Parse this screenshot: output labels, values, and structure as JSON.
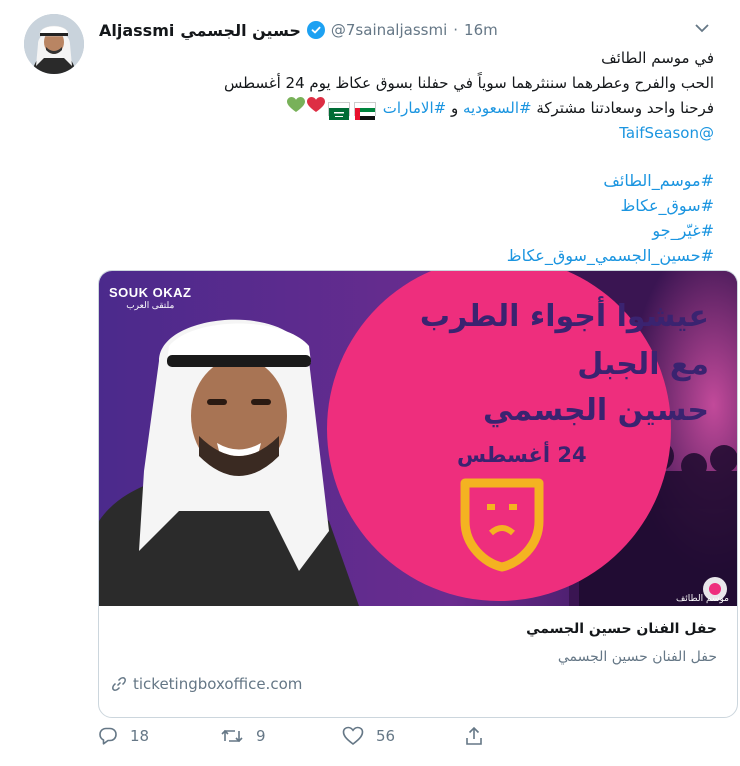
{
  "tweet": {
    "display_name_latin": "Aljassmi",
    "display_name_arabic": "حسين الجسمي",
    "handle": "@7sainaljassmi",
    "separator": "·",
    "time": "16m",
    "verified": true,
    "lines": [
      "في موسم الطائف",
      "الحب والفرح وعطرهما سننثرهما سوياً في حفلنا بسوق عكاظ يوم 24 أغسطس"
    ],
    "line3": {
      "prefix": "فرحنا واحد وسعادتنا مشتركة ",
      "hashtag_saudi": "#السعوديه",
      "and": " و ",
      "hashtag_uae": "#الامارات"
    },
    "mention": "@TaifSeason",
    "hashtags": [
      "#موسم_الطائف",
      "#سوق_عكاظ",
      "#غيّر_جو",
      "#حسين_الجسمي_سوق_عكاظ"
    ]
  },
  "card": {
    "image": {
      "logo": "SOUK OKAZ",
      "logo_sub": "ملتقى العرب",
      "heading_line1": "عيشوا أجواء الطرب",
      "heading_line2": "مع الجبل",
      "heading_line3": "حسين الجسمي",
      "date": "24 أغسطس",
      "corner_text": "موسم الطائف"
    },
    "title": "حفل الفنان حسين الجسمي",
    "description": "حفل الفنان حسين الجسمي",
    "domain": "ticketingboxoffice.com"
  },
  "actions": {
    "replies": "18",
    "retweets": "9",
    "likes": "56"
  },
  "colors": {
    "link": "#1b95e0",
    "muted": "#657786",
    "verified": "#1da1f2",
    "poster_purple": "#4b2a8c",
    "poster_pink": "#ee2e7d",
    "poster_gold": "#f4b321"
  }
}
